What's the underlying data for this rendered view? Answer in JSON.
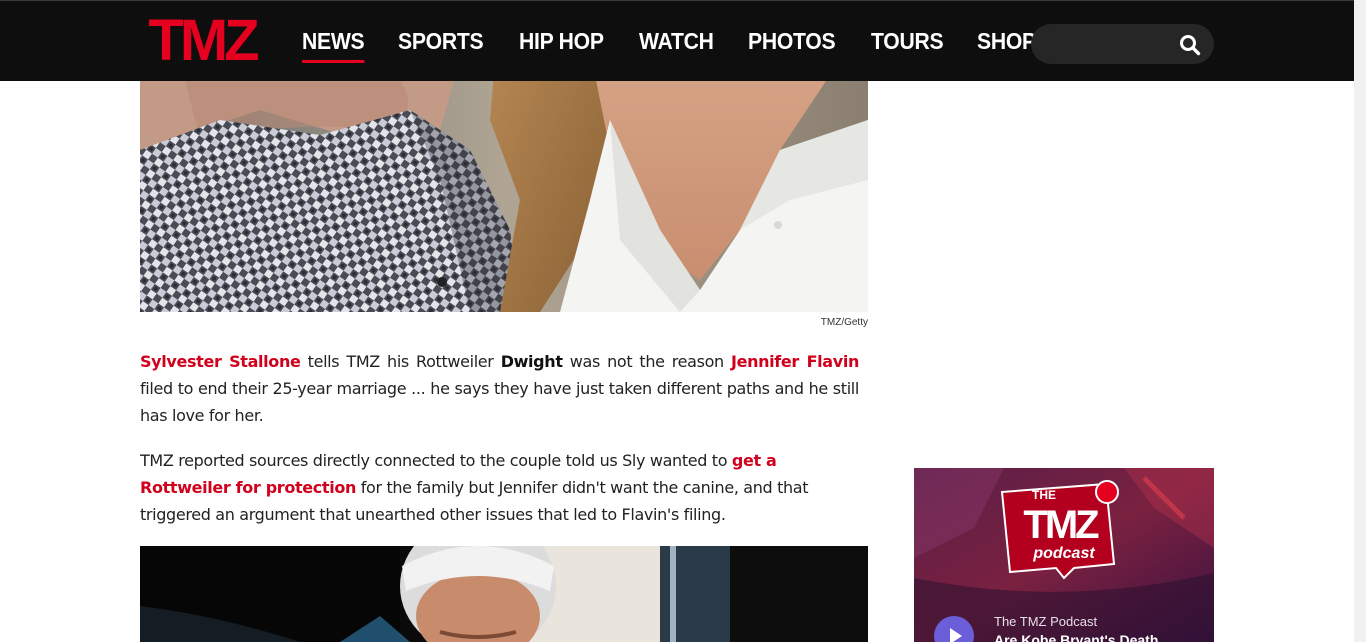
{
  "brand": {
    "logo_text": "TMZ",
    "accent": "#e4001e",
    "link_color": "#d1001c"
  },
  "nav": {
    "items": [
      {
        "label": "NEWS",
        "active": true
      },
      {
        "label": "SPORTS"
      },
      {
        "label": "HIP HOP"
      },
      {
        "label": "WATCH"
      },
      {
        "label": "PHOTOS"
      },
      {
        "label": "TOURS"
      },
      {
        "label": "SHOP"
      }
    ],
    "search": {
      "placeholder": "",
      "icon": "search-icon"
    }
  },
  "article": {
    "photo_credit": "TMZ/Getty",
    "paragraph1": {
      "link1": "Sylvester Stallone",
      "text1": " tells TMZ his Rottweiler ",
      "bold1": "Dwight",
      "text2": " was not the reason ",
      "link2": "Jennifer Flavin",
      "text3": " filed to end their 25-year marriage ... he says they have just taken different paths and he still has love for her."
    },
    "paragraph2": {
      "text1": "TMZ reported sources directly connected to the couple told us Sly wanted to ",
      "link1": "get a Rottweiler for protection",
      "text2": " for the family but Jennifer didn't want the canine, and that triggered an argument that unearthed other issues that led to Flavin's filing."
    }
  },
  "podcast_widget": {
    "logo_line1": "THE",
    "logo_line2": "TMZ",
    "logo_line3": "podcast",
    "show_name": "The TMZ Podcast",
    "episode_title": "Are Kobe Bryant's Death",
    "play_icon": "play-icon"
  }
}
